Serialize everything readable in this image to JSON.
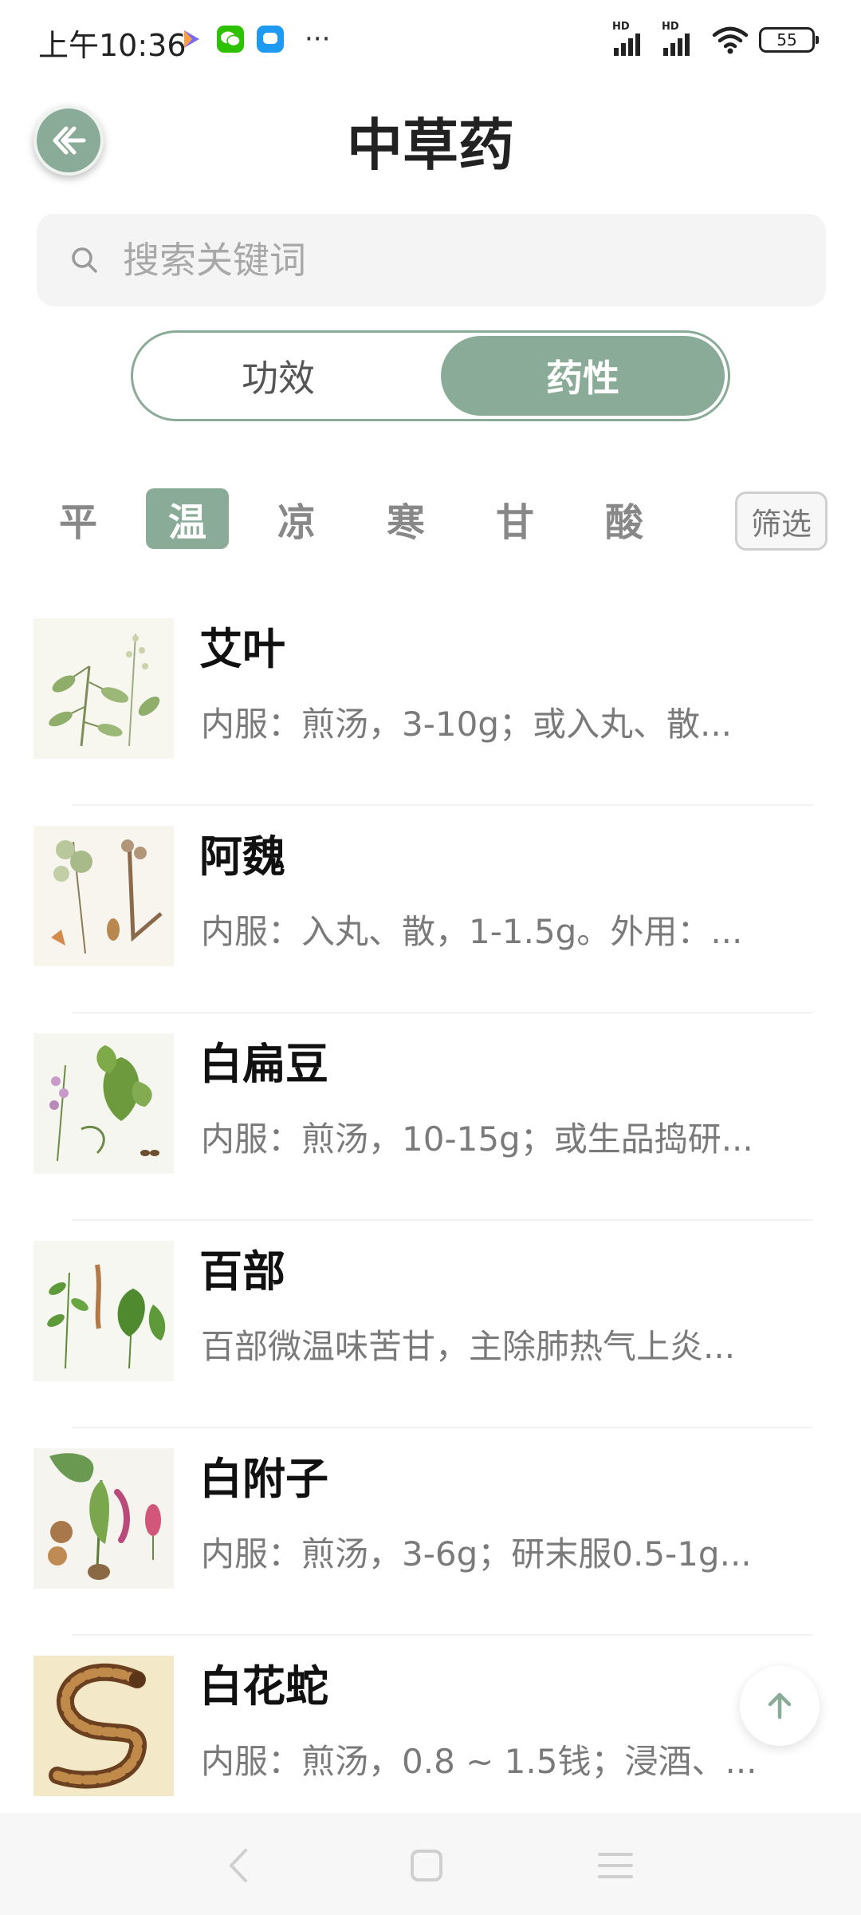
{
  "status_bar": {
    "time": "上午10:36",
    "more": "···",
    "battery": "55",
    "signal_label": "HD",
    "apps": [
      "play-app-icon",
      "wechat-icon",
      "message-app-icon"
    ]
  },
  "header": {
    "title": "中草药",
    "back_icon": "back-arrow-icon"
  },
  "search": {
    "placeholder": "搜索关键词"
  },
  "segment": {
    "tabs": [
      {
        "label": "功效",
        "selected": false
      },
      {
        "label": "药性",
        "selected": true
      }
    ]
  },
  "chips": {
    "items": [
      {
        "label": "平",
        "selected": false
      },
      {
        "label": "温",
        "selected": true
      },
      {
        "label": "凉",
        "selected": false
      },
      {
        "label": "寒",
        "selected": false
      },
      {
        "label": "甘",
        "selected": false
      },
      {
        "label": "酸",
        "selected": false
      }
    ],
    "filter_label": "筛选"
  },
  "herbs": [
    {
      "name": "艾叶",
      "desc": "内服：煎汤，3-10g；或入丸、散..."
    },
    {
      "name": "阿魏",
      "desc": "内服：入丸、散，1-1.5g。外用：..."
    },
    {
      "name": "白扁豆",
      "desc": "内服：煎汤，10-15g；或生品捣研..."
    },
    {
      "name": "百部",
      "desc": "百部微温味苦甘，主除肺热气上炎..."
    },
    {
      "name": "白附子",
      "desc": "内服：煎汤，3-6g；研末服0.5-1g..."
    },
    {
      "name": "白花蛇",
      "desc": "内服：煎汤，0.8 ~ 1.5钱；浸酒、..."
    }
  ],
  "colors": {
    "accent": "#8aab97",
    "search_bg": "#f4f4f4",
    "text_secondary": "#7a7a7a"
  }
}
